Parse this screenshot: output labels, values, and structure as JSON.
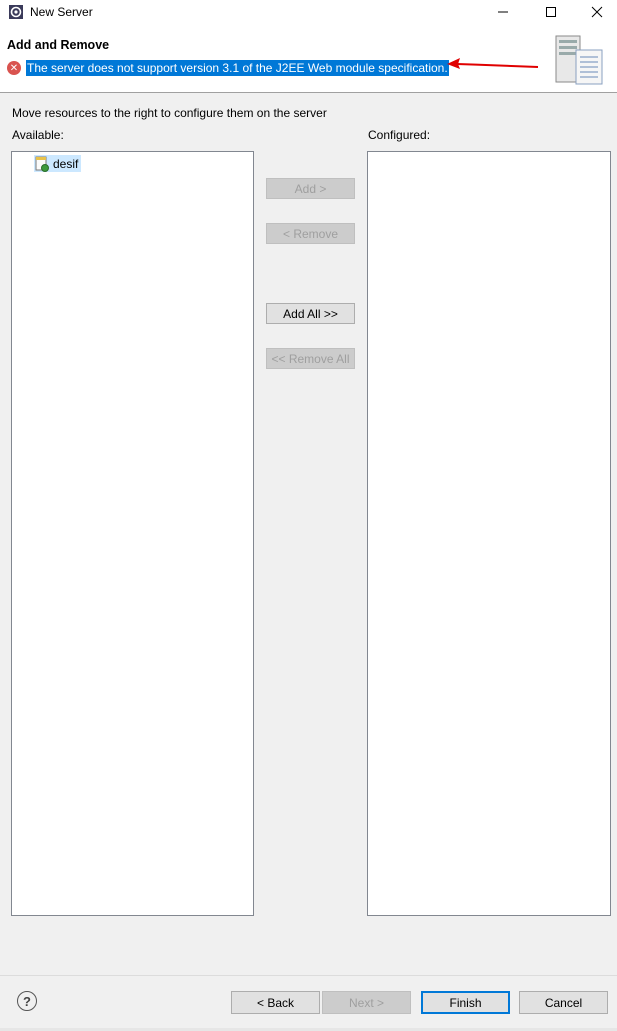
{
  "window": {
    "title": "New Server",
    "minimize_icon": "minimize-icon",
    "maximize_icon": "maximize-icon",
    "close_icon": "close-icon"
  },
  "banner": {
    "title": "Add and Remove",
    "error_message": "The server does not support version 3.1 of the J2EE Web module specification.",
    "error_icon": "error-icon",
    "annotation": "red-arrow",
    "banner_icon": "server-icon"
  },
  "content": {
    "instructions": "Move resources to the right to configure them on the server",
    "available_label": "Available:",
    "configured_label": "Configured:",
    "available_items": [
      {
        "label": "desif",
        "icon": "project-icon",
        "selected": true
      }
    ],
    "configured_items": []
  },
  "buttons": {
    "add": "Add >",
    "remove": "< Remove",
    "add_all": "Add All >>",
    "remove_all": "<< Remove All"
  },
  "footer": {
    "help_icon": "help-icon",
    "back": "< Back",
    "next": "Next >",
    "finish": "Finish",
    "cancel": "Cancel"
  },
  "colors": {
    "selection": "#0078d7",
    "error": "#d9534f",
    "arrow": "#e00000",
    "tree_selection": "#cce8ff"
  }
}
